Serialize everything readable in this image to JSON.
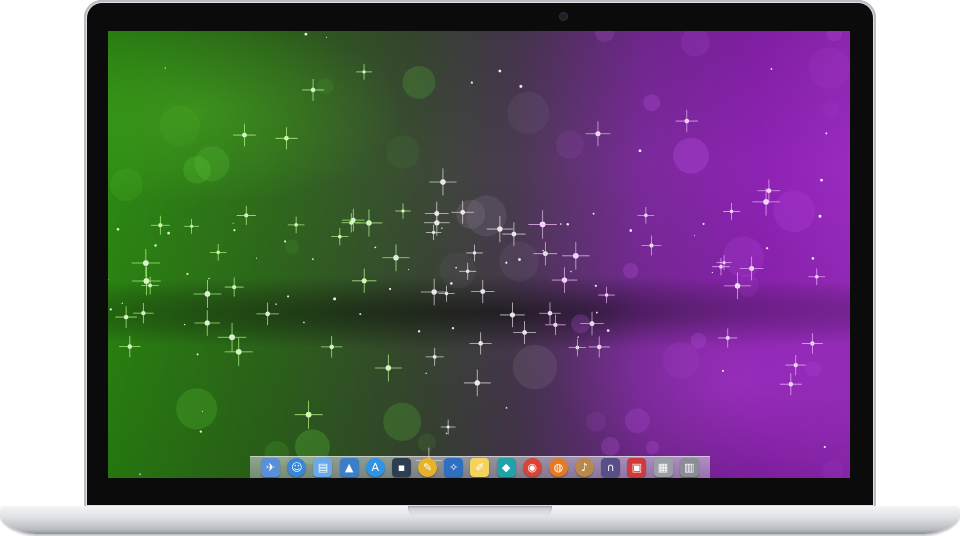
{
  "wallpaper": {
    "description_colors": [
      "#2c8a12",
      "#4a3a52",
      "#9a2bc0"
    ]
  },
  "dock": {
    "items": [
      {
        "name": "launchpad-icon",
        "glyph": "✈",
        "color": "#5b8fd8"
      },
      {
        "name": "finder-icon",
        "glyph": "☺",
        "color": "#3a86d6"
      },
      {
        "name": "preview-icon",
        "glyph": "▤",
        "color": "#6aa9e8"
      },
      {
        "name": "xcode-icon",
        "glyph": "▲",
        "color": "#3d7fc6"
      },
      {
        "name": "app-store-icon",
        "glyph": "A",
        "color": "#2f93e6"
      },
      {
        "name": "terminal-icon",
        "glyph": "▪",
        "color": "#2c3e50"
      },
      {
        "name": "sketchbook-icon",
        "glyph": "✎",
        "color": "#e8b12a"
      },
      {
        "name": "network-icon",
        "glyph": "✧",
        "color": "#2f6fc0"
      },
      {
        "name": "notes-icon",
        "glyph": "✐",
        "color": "#f3d35b"
      },
      {
        "name": "device-icon",
        "glyph": "◆",
        "color": "#1fa3a8"
      },
      {
        "name": "chrome-icon",
        "glyph": "◉",
        "color": "#d94436"
      },
      {
        "name": "firefox-icon",
        "glyph": "◍",
        "color": "#e67a22"
      },
      {
        "name": "itunes-icon",
        "glyph": "♪",
        "color": "#b8894a"
      },
      {
        "name": "magnet-icon",
        "glyph": "∩",
        "color": "#5a4e88"
      },
      {
        "name": "photo-viewer-icon",
        "glyph": "▣",
        "color": "#cf3b3b"
      },
      {
        "name": "file-manager-icon",
        "glyph": "▦",
        "color": "#9a9ea6"
      },
      {
        "name": "trash-icon",
        "glyph": "▥",
        "color": "#8a8d94"
      }
    ]
  }
}
